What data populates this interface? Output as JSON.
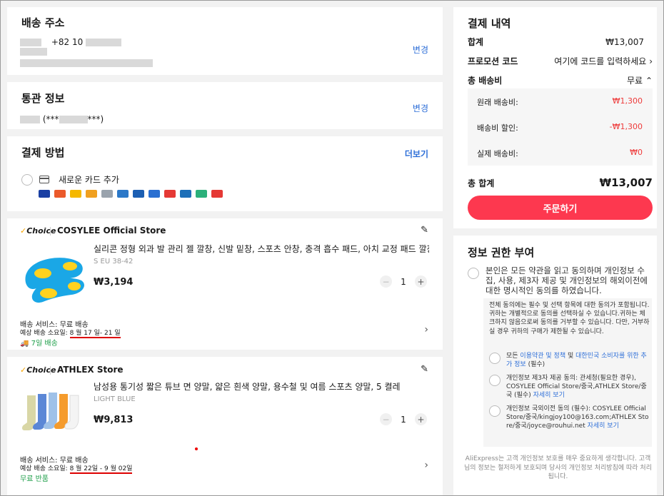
{
  "address": {
    "title": "배송 주소",
    "phone": "+82 10",
    "change_label": "변경"
  },
  "customs": {
    "title": "통관 정보",
    "id_masked_start": "(***",
    "id_masked_end": "***)",
    "change_label": "변경"
  },
  "payment": {
    "title": "결제 방법",
    "more_label": "더보기",
    "add_card_label": "새로운 카드 추가",
    "brands": [
      {
        "name": "visa",
        "color": "#1a3fa3"
      },
      {
        "name": "mastercard",
        "color": "#eb5a2b"
      },
      {
        "name": "brand-3",
        "color": "#f5b800"
      },
      {
        "name": "brand-4",
        "color": "#f0a020"
      },
      {
        "name": "brand-5",
        "color": "#9aa3ad"
      },
      {
        "name": "brand-6",
        "color": "#2b78c8"
      },
      {
        "name": "brand-7",
        "color": "#1c5fb3"
      },
      {
        "name": "amex",
        "color": "#2a6fd1"
      },
      {
        "name": "brand-9",
        "color": "#e53935"
      },
      {
        "name": "jcb",
        "color": "#1d6fb8"
      },
      {
        "name": "brand-11",
        "color": "#2bb07a"
      },
      {
        "name": "brand-12",
        "color": "#e53935"
      }
    ]
  },
  "stores": [
    {
      "choice_label": "Choice",
      "store_name": "COSYLEE Official Store",
      "product_title": "실리콘 정형 외과 발 관리 젤 깔창, 신발 밑창, 스포츠 안창, 충격 흡수 패드, 아치 교정 패드 깔창",
      "variant": "S EU 38-42",
      "price": "₩3,194",
      "quantity": "1",
      "shipping_service": "배송 서비스: 무료 배송",
      "est_label": "예상 배송 소요일: ",
      "est_dates": "8 월 17 일- 21 일",
      "badge": "7일 배송"
    },
    {
      "choice_label": "Choice",
      "store_name": "ATHLEX Store",
      "product_title": "남성용 통기성 짧은 튜브 면 양말, 얇은 흰색 양말, 용수철 및 여름 스포츠 양말, 5 켤레",
      "variant": "LIGHT BLUE",
      "price": "₩9,813",
      "quantity": "1",
      "shipping_service": "배송 서비스: 무료 배송",
      "est_label": "예상 배송 소요일: ",
      "est_dates": "8 월 22일 - 9 월 02일",
      "badge": "무료 반품"
    }
  ],
  "summary": {
    "title": "결제 내역",
    "subtotal_label": "합계",
    "subtotal_value": "₩13,007",
    "promo_label": "프로모션 코드",
    "promo_value": "여기에 코드를 입력하세요",
    "shipping_label": "총 배송비",
    "shipping_value": "무료",
    "shipping_rows": [
      {
        "label": "원래 배송비:",
        "value": "₩1,300"
      },
      {
        "label": "배송비 할인:",
        "value": "-₩1,300"
      },
      {
        "label": "실제 배송비:",
        "value": "₩0"
      }
    ],
    "total_label": "총 합계",
    "total_value": "₩13,007",
    "order_button": "주문하기",
    "accent_color": "#fd384f"
  },
  "consent": {
    "title": "정보 권한 부여",
    "main_text": "본인은 모든 약관을 읽고 동의하며 개인정보 수집, 사용, 제3자 제공 및 개인정보의 해외이전에 대한 명시적인 동의를 하였습니다.",
    "notice": "전체 동의에는 필수 및 선택 항목에 대한 동의가 포함됩니다. 귀하는 개별적으로 동의를 선택하실 수 있습니다.귀하는 체크하지 않음으로써 동의를 거부할 수 있습니다. 다만, 거부하실 경우 귀하의 구매가 제한될 수 있습니다.",
    "item1": {
      "prefix": "모든 ",
      "link1": "이용약관 및 정책",
      "mid": " 및 ",
      "link2": "대한민국 소비자를 위한 추가 정보",
      "suffix": " (필수)"
    },
    "item2": {
      "text": "개인정보 제3자 제공 동의: 관세청(필요한 경우), COSYLEE Official Store/중국,ATHLEX Store/중국 (필수) ",
      "link": "자세히 보기"
    },
    "item3": {
      "text": "개인정보 국외이전 동의 (필수): COSYLEE Official Store/중국/kingjoy100@163.com;ATHLEX Store/중국/joyce@rouhui.net ",
      "link": "자세히 보기"
    },
    "footer": "AliExpress는 고객 개인정보 보호를 매우 중요하게 생각합니다. 고객님의 정보는 철저하게 보호되며 당사의 개인정보 처리방침에 따라 처리됩니다."
  }
}
